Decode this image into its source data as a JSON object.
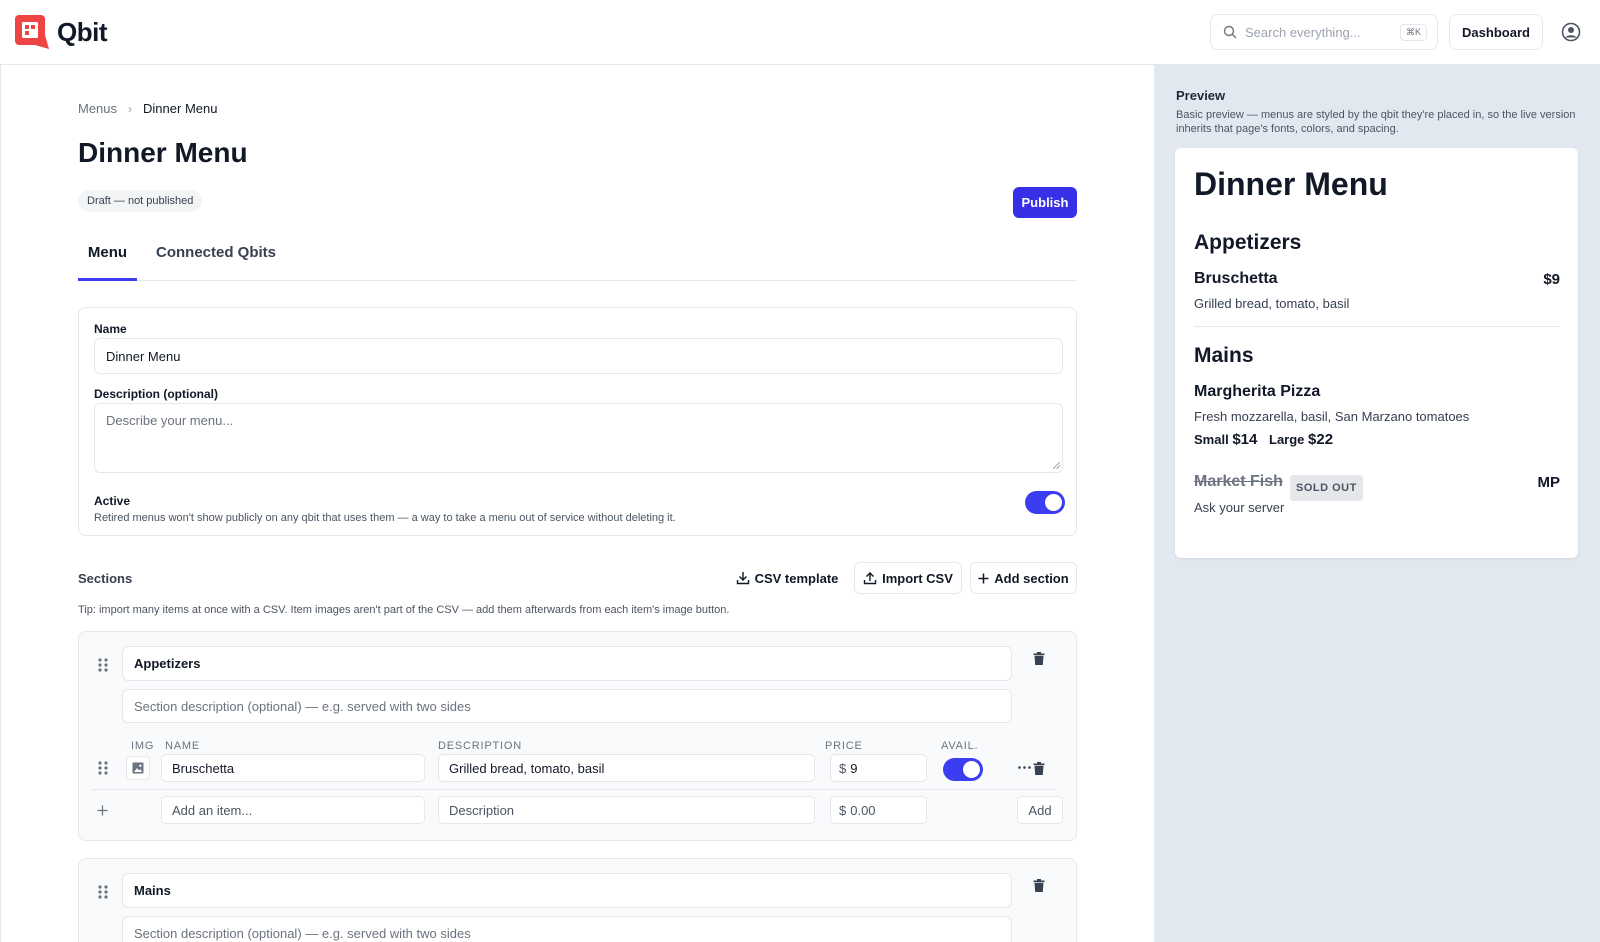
{
  "header": {
    "brand": "Qbit",
    "search_placeholder": "Search everything...",
    "search_shortcut": "⌘K",
    "dashboard_label": "Dashboard"
  },
  "breadcrumb": {
    "parent": "Menus",
    "current": "Dinner Menu"
  },
  "page": {
    "title": "Dinner Menu",
    "status_badge": "Draft — not published",
    "publish_label": "Publish"
  },
  "tabs": [
    {
      "label": "Menu",
      "active": true
    },
    {
      "label": "Connected Qbits",
      "active": false
    }
  ],
  "form": {
    "name_label": "Name",
    "name_value": "Dinner Menu",
    "description_label": "Description (optional)",
    "description_placeholder": "Describe your menu...",
    "active_label": "Active",
    "active_help": "Retired menus won't show publicly on any qbit that uses them — a way to take a menu out of service without deleting it.",
    "active_on": true
  },
  "sections_toolbar": {
    "title": "Sections",
    "csv_template_label": "CSV template",
    "import_csv_label": "Import CSV",
    "add_section_label": "Add section",
    "tip": "Tip: import many items at once with a CSV. Item images aren't part of the CSV — add them afterwards from each item's image button."
  },
  "columns": {
    "img": "IMG",
    "name": "NAME",
    "description": "DESCRIPTION",
    "price": "PRICE",
    "avail": "AVAIL."
  },
  "sections": [
    {
      "name": "Appetizers",
      "description_placeholder": "Section description (optional) — e.g. served with two sides",
      "items": [
        {
          "name": "Bruschetta",
          "description": "Grilled bread, tomato, basil",
          "currency": "$",
          "price": "9",
          "available": true
        }
      ],
      "new_item": {
        "name_placeholder": "Add an item...",
        "description_placeholder": "Description",
        "currency": "$",
        "price_placeholder": "0.00",
        "add_label": "Add"
      }
    },
    {
      "name": "Mains",
      "description_placeholder": "Section description (optional) — e.g. served with two sides"
    }
  ],
  "preview": {
    "title": "Preview",
    "note": "Basic preview — menus are styled by the qbit they're placed in, so the live version inherits that page's fonts, colors, and spacing.",
    "menu_title": "Dinner Menu",
    "sections": [
      {
        "name": "Appetizers",
        "items": [
          {
            "name": "Bruschetta",
            "price": "$9",
            "description": "Grilled bread, tomato, basil"
          }
        ]
      },
      {
        "name": "Mains",
        "items": [
          {
            "name": "Margherita Pizza",
            "description": "Fresh mozzarella, basil, San Marzano tomatoes",
            "sizes": [
              {
                "label": "Small",
                "price": "$14"
              },
              {
                "label": "Large",
                "price": "$22"
              }
            ]
          },
          {
            "name": "Market Fish",
            "badge": "SOLD OUT",
            "price": "MP",
            "description": "Ask your server"
          }
        ]
      }
    ]
  },
  "colors": {
    "accent": "#3b3ef0",
    "brand_logo": "#ef4444",
    "preview_bg": "#e2e8f0"
  }
}
